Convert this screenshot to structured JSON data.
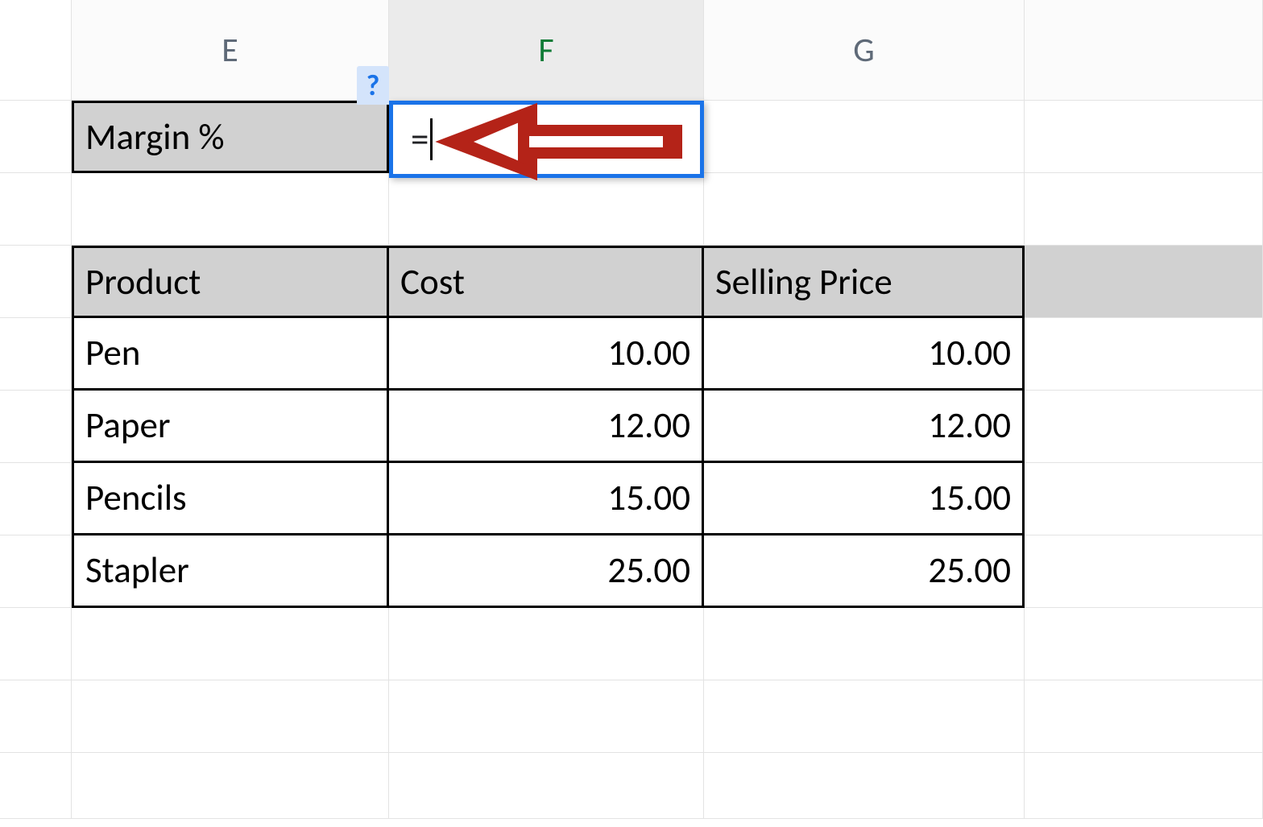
{
  "columns": {
    "E": "E",
    "F": "F",
    "G": "G"
  },
  "margin": {
    "label": "Margin %",
    "hint": "?",
    "formula": "="
  },
  "table": {
    "headers": {
      "product": "Product",
      "cost": "Cost",
      "price": "Selling Price"
    },
    "rows": [
      {
        "product": "Pen",
        "cost": "10.00",
        "price": "10.00"
      },
      {
        "product": "Paper",
        "cost": "12.00",
        "price": "12.00"
      },
      {
        "product": "Pencils",
        "cost": "15.00",
        "price": "15.00"
      },
      {
        "product": "Stapler",
        "cost": "25.00",
        "price": "25.00"
      }
    ]
  },
  "colors": {
    "accent": "#1a73e8",
    "arrow": "#b42318"
  }
}
